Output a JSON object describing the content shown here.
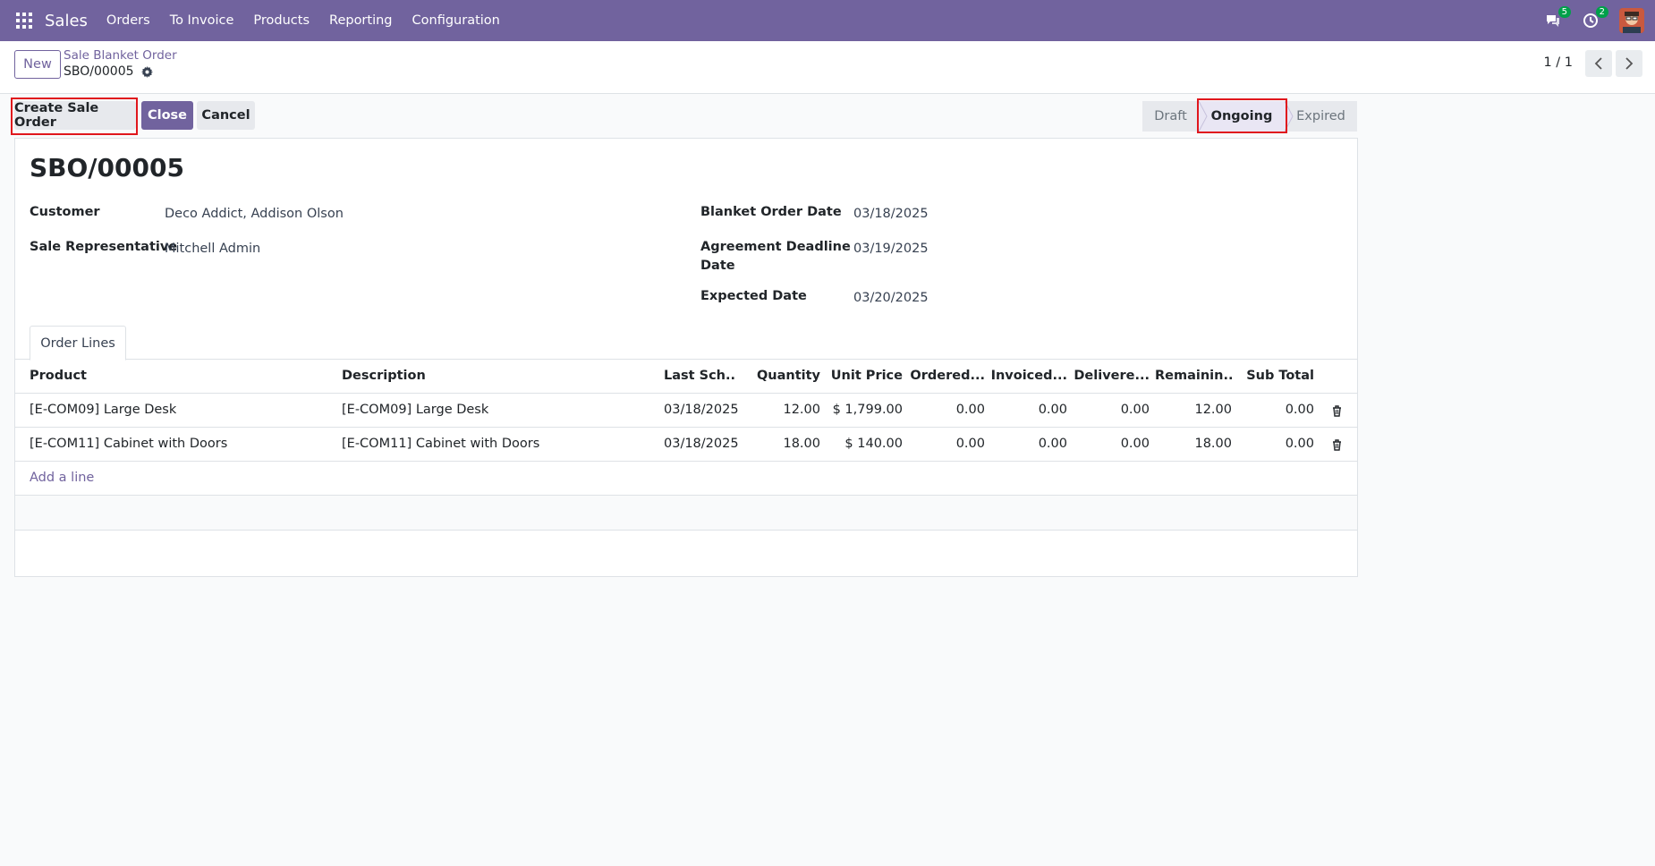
{
  "navbar": {
    "brand": "Sales",
    "menu": [
      "Orders",
      "To Invoice",
      "Products",
      "Reporting",
      "Configuration"
    ],
    "messages_badge": "5",
    "activities_badge": "2"
  },
  "control_panel": {
    "new_label": "New",
    "breadcrumb": "Sale Blanket Order",
    "record": "SBO/00005",
    "pager": "1 / 1"
  },
  "actions": {
    "create_sale_order": "Create Sale Order",
    "close": "Close",
    "cancel": "Cancel"
  },
  "statusbar": {
    "stages": [
      "Draft",
      "Ongoing",
      "Expired"
    ],
    "active": "Ongoing"
  },
  "form": {
    "title": "SBO/00005",
    "customer_label": "Customer",
    "customer": "Deco Addict, Addison Olson",
    "rep_label": "Sale Representative",
    "rep": "Mitchell Admin",
    "order_date_label": "Blanket Order Date",
    "order_date": "03/18/2025",
    "deadline_label_1": "Agreement Deadline",
    "deadline_label_2": "Date",
    "deadline": "03/19/2025",
    "expected_label": "Expected Date",
    "expected": "03/20/2025"
  },
  "tabs": {
    "order_lines": "Order Lines"
  },
  "table": {
    "headers": [
      "Product",
      "Description",
      "Last Sch...",
      "Quantity",
      "Unit Price",
      "Ordered...",
      "Invoiced...",
      "Delivere...",
      "Remainin...",
      "Sub Total"
    ],
    "rows": [
      [
        "[E-COM09] Large Desk",
        "[E-COM09] Large Desk",
        "03/18/2025",
        "12.00",
        "$ 1,799.00",
        "0.00",
        "0.00",
        "0.00",
        "12.00",
        "0.00"
      ],
      [
        "[E-COM11] Cabinet with Doors",
        "[E-COM11] Cabinet with Doors",
        "03/18/2025",
        "18.00",
        "$ 140.00",
        "0.00",
        "0.00",
        "0.00",
        "18.00",
        "0.00"
      ]
    ],
    "add_line": "Add a line"
  },
  "colors": {
    "brand": "#71639e",
    "highlight": "#e0171d"
  }
}
